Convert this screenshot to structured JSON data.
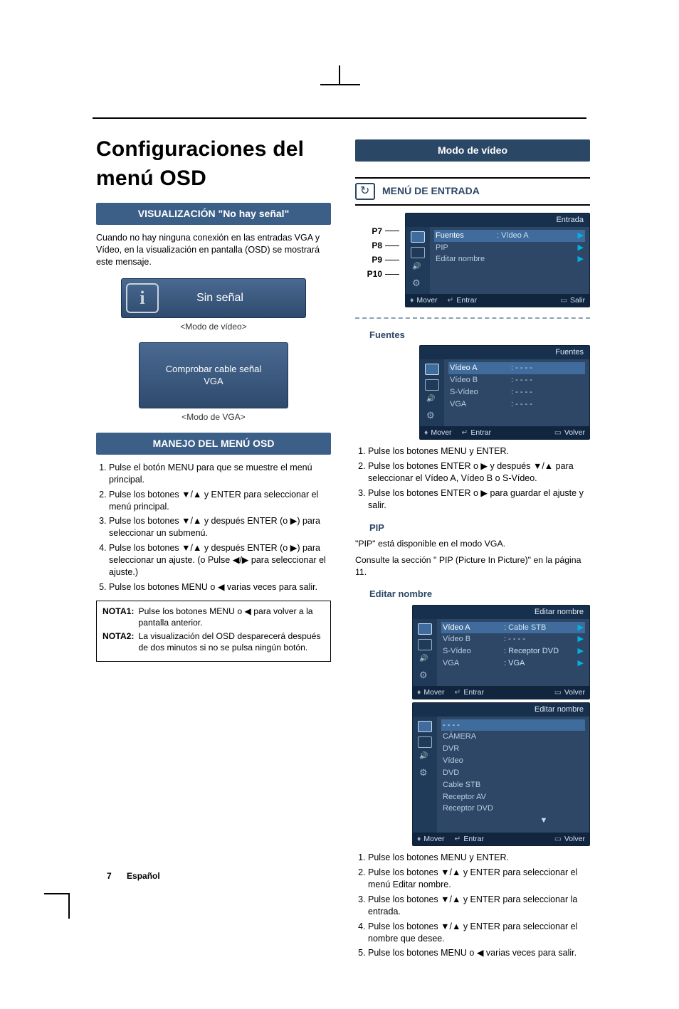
{
  "left": {
    "h1": "Configuraciones del menú OSD",
    "bar_nosig": "VISUALIZACIÓN \"No hay señal\"",
    "para_nosig": "Cuando no hay ninguna conexión en las entradas VGA y Vídeo, en la visualización en pantalla (OSD) se mostrará este mensaje.",
    "ns1_text": "Sin señal",
    "ns1_cap": "<Modo de vídeo>",
    "ns2_text1": "Comprobar cable señal",
    "ns2_text2": "VGA",
    "ns2_cap": "<Modo de VGA>",
    "bar_osd": "MANEJO DEL MENÚ OSD",
    "steps_osd": [
      "Pulse el botón MENU para que se muestre el menú principal.",
      "Pulse los botones ▼/▲ y ENTER para seleccionar el menú principal.",
      "Pulse los botones ▼/▲ y después ENTER (o ▶) para seleccionar un submenú.",
      "Pulse los botones ▼/▲ y después ENTER (o ▶) para seleccionar un ajuste. (o Pulse ◀/▶ para seleccionar el ajuste.)",
      "Pulse los botones MENU o ◀ varias veces para salir."
    ],
    "note1_label": "NOTA1:",
    "note1_text": "Pulse los botones MENU o ◀ para volver a la pantalla anterior.",
    "note2_label": "NOTA2:",
    "note2_text": "La visualización del OSD desparecerá después de dos minutos si no se pulsa ningún botón."
  },
  "right": {
    "bar_mode": "Modo de vídeo",
    "menu_header": "MENÚ DE ENTRADA",
    "plabels": [
      "P7",
      "P8",
      "P9",
      "P10"
    ],
    "osd_entrada": {
      "title": "Entrada",
      "rows": [
        {
          "k": "Fuentes",
          "v": ": Vídeo A",
          "sel": true,
          "arr": true
        },
        {
          "k": "PIP",
          "v": "",
          "sel": false,
          "arr": true
        },
        {
          "k": "Editar nombre",
          "v": "",
          "sel": false,
          "arr": true
        }
      ],
      "footer": {
        "move": "Mover",
        "enter": "Entrar",
        "exit": "Salir"
      }
    },
    "fuentes_head": "Fuentes",
    "osd_fuentes": {
      "title": "Fuentes",
      "rows": [
        {
          "k": "Vídeo A",
          "v": ": - - - -",
          "sel": true,
          "arr": false
        },
        {
          "k": "Vídeo B",
          "v": ": - - - -",
          "sel": false,
          "arr": false
        },
        {
          "k": "S-Vídeo",
          "v": ": - - - -",
          "sel": false,
          "arr": false
        },
        {
          "k": "VGA",
          "v": ": - - - -",
          "sel": false,
          "arr": false
        }
      ],
      "footer": {
        "move": "Mover",
        "enter": "Entrar",
        "exit": "Volver"
      }
    },
    "steps_fuentes": [
      "Pulse los botones MENU y ENTER.",
      "Pulse los botones ENTER o ▶ y después ▼/▲ para seleccionar el Vídeo A, Vídeo B o S-Vídeo.",
      "Pulse los botones ENTER o ▶ para guardar el ajuste y salir."
    ],
    "pip_head": "PIP",
    "pip_l1": "\"PIP\" está disponible en el modo VGA.",
    "pip_l2": "Consulte la sección \"     PIP (Picture In Picture)\" en la página 11.",
    "editar_head": "Editar nombre",
    "osd_editar1": {
      "title": "Editar nombre",
      "rows": [
        {
          "k": "Vídeo A",
          "v": ": Cable STB",
          "sel": true,
          "arr": true
        },
        {
          "k": "Vídeo B",
          "v": ": - - - -",
          "sel": false,
          "arr": true
        },
        {
          "k": "S-Vídeo",
          "v": ": Receptor DVD",
          "sel": false,
          "arr": true
        },
        {
          "k": "VGA",
          "v": ": VGA",
          "sel": false,
          "arr": true
        }
      ],
      "footer": {
        "move": "Mover",
        "enter": "Entrar",
        "exit": "Volver"
      }
    },
    "osd_editar2": {
      "title": "Editar nombre",
      "rows": [
        {
          "k": "- - - -",
          "sel": true
        },
        {
          "k": "CÁMERA"
        },
        {
          "k": "DVR"
        },
        {
          "k": "Vídeo"
        },
        {
          "k": "DVD"
        },
        {
          "k": "Cable STB"
        },
        {
          "k": "Receptor AV"
        },
        {
          "k": "Receptor DVD"
        }
      ],
      "footer": {
        "move": "Mover",
        "enter": "Entrar",
        "exit": "Volver"
      }
    },
    "steps_editar": [
      "Pulse los botones MENU y ENTER.",
      "Pulse los botones ▼/▲ y ENTER para seleccionar el menú Editar nombre.",
      "Pulse los botones ▼/▲ y ENTER para seleccionar la entrada.",
      "Pulse los botones ▼/▲ y ENTER para seleccionar el nombre que desee.",
      "Pulse los botones MENU o ◀ varias veces para salir."
    ]
  },
  "footer": {
    "num": "7",
    "lang": "Español"
  }
}
